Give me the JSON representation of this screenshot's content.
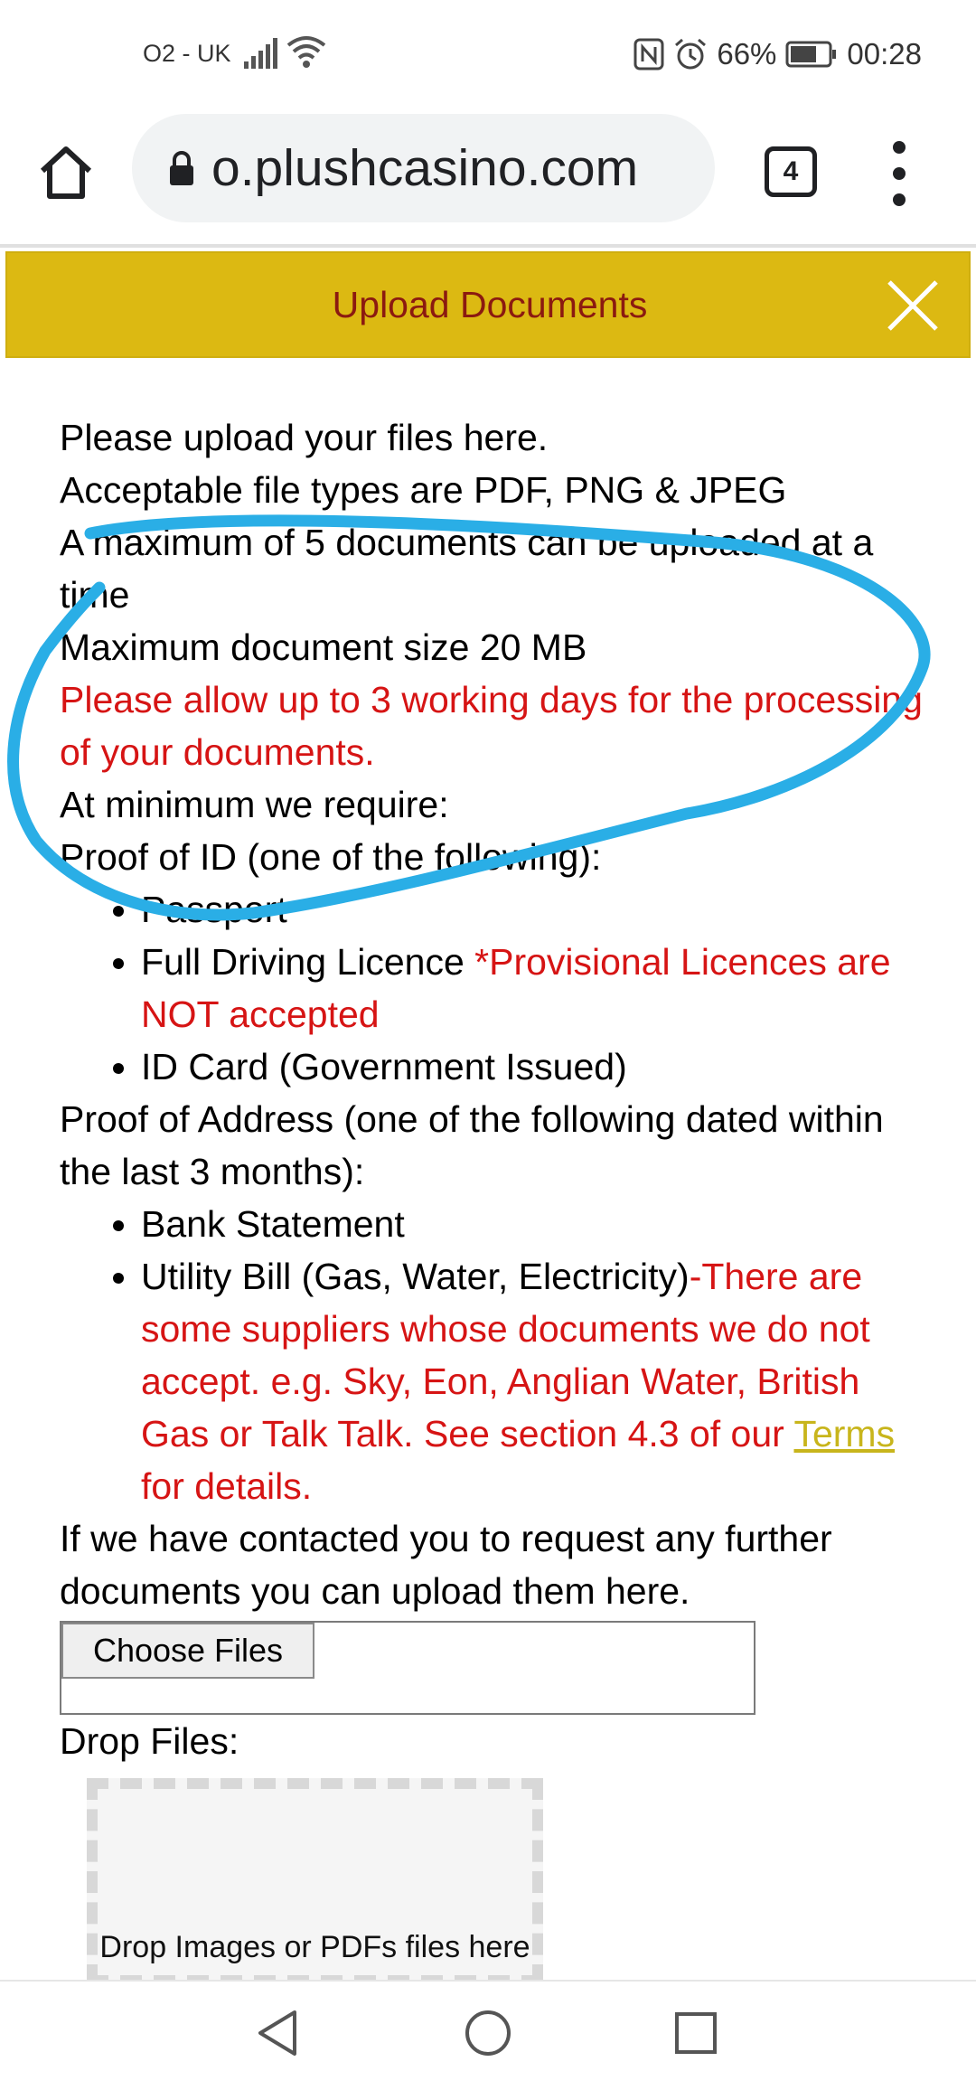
{
  "status_bar": {
    "carrier": "O2 - UK",
    "battery": "66%",
    "time": "00:28"
  },
  "browser": {
    "url": "o.plushcasino.com",
    "tab_count": "4"
  },
  "modal": {
    "title": "Upload Documents",
    "line1": "Please upload your files here.",
    "line2": "Acceptable file types are PDF, PNG & JPEG",
    "line3": "A maximum of 5 documents can be uploaded at a time",
    "line4": "Maximum document size 20 MB",
    "processing_notice": "Please allow up to 3 working days for the processing of your documents.",
    "min_required": "At minimum we require:",
    "proof_id_heading": "Proof of ID (one of the following):",
    "id_passport": "Passport",
    "id_driving": "Full Driving Licence ",
    "id_driving_note": "*Provisional Licences are NOT accepted",
    "id_card": "ID Card (Government Issued)",
    "proof_address_heading": "Proof of Address (one of the following dated within the last 3 months):",
    "addr_bank": "Bank Statement",
    "addr_utility": "Utility Bill (Gas, Water, Electricity)",
    "addr_utility_note": "-There are some suppliers whose documents we do not accept. e.g. Sky, Eon, Anglian Water, British Gas or Talk Talk. See section 4.3 of our ",
    "terms_link": "Terms",
    "addr_utility_note_end": " for details.",
    "further_docs": "If we have contacted you to request any further documents you can upload them here.",
    "choose_files": "Choose Files",
    "drop_files_label": "Drop Files:",
    "drop_zone_text": "Drop Images or PDFs files here"
  },
  "colors": {
    "header_bg": "#dcb912",
    "header_text": "#8b1a10",
    "warning_red": "#d61414",
    "annotation_blue": "#2aaee6",
    "link": "#c8b51c"
  }
}
